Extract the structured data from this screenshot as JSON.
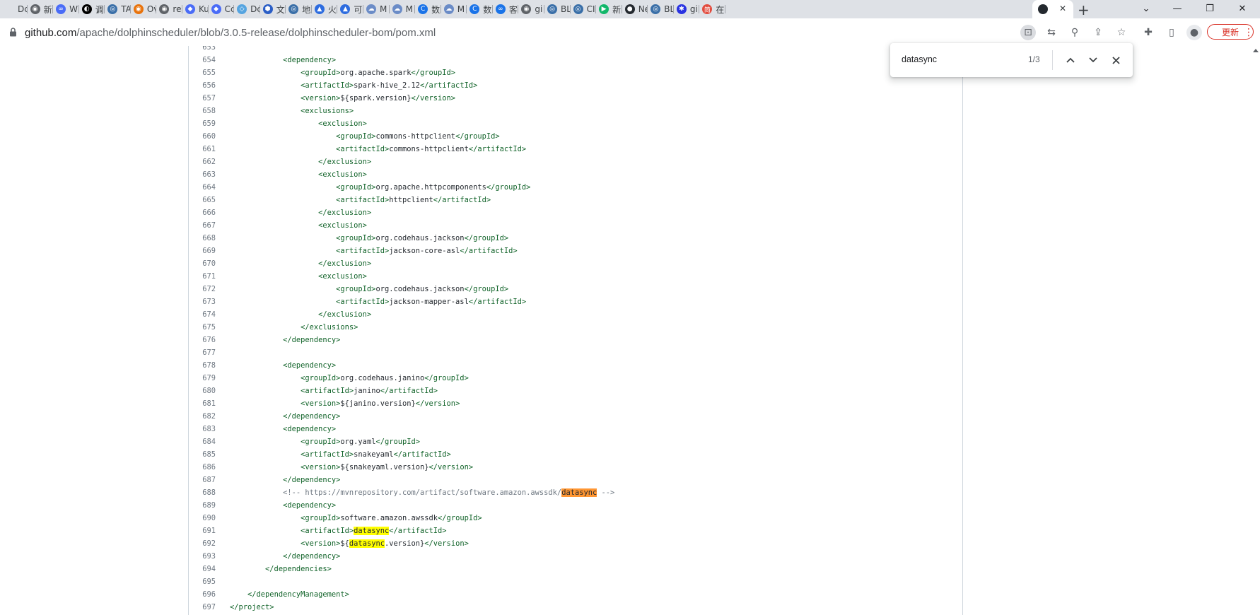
{
  "tabs": [
    {
      "label": "Dc",
      "icon": "doc-icon",
      "color": "#dee1e6",
      "glyph": ""
    },
    {
      "label": "新",
      "icon": "globe-icon",
      "color": "#5f6368",
      "glyph": "◉"
    },
    {
      "label": "W",
      "icon": "link-icon",
      "color": "#4a6cf7",
      "glyph": "∞"
    },
    {
      "label": "调",
      "icon": "compass-icon",
      "color": "#000000",
      "glyph": "◐"
    },
    {
      "label": "TA",
      "icon": "chrome-site-icon",
      "color": "#3a6fa8",
      "glyph": "◎"
    },
    {
      "label": "Ov",
      "icon": "orange-circle-icon",
      "color": "#e8730c",
      "glyph": "◉"
    },
    {
      "label": "re",
      "icon": "globe-icon",
      "color": "#5f6368",
      "glyph": "◉"
    },
    {
      "label": "Ku",
      "icon": "kuboard-icon",
      "color": "#4a6cf7",
      "glyph": "◆"
    },
    {
      "label": "Cc",
      "icon": "kuboard-icon",
      "color": "#4a6cf7",
      "glyph": "◆"
    },
    {
      "label": "Dc",
      "icon": "dolphin-icon",
      "color": "#55a4e0",
      "glyph": "◇"
    },
    {
      "label": "文",
      "icon": "hexagon-icon",
      "color": "#2b5ec6",
      "glyph": "⬢"
    },
    {
      "label": "地",
      "icon": "chrome-site-icon",
      "color": "#3a6fa8",
      "glyph": "◎"
    },
    {
      "label": "火",
      "icon": "volcano-icon",
      "color": "#2d6cdf",
      "glyph": "▲"
    },
    {
      "label": "可",
      "icon": "volcano-icon",
      "color": "#2d6cdf",
      "glyph": "▲"
    },
    {
      "label": "M",
      "icon": "cloud-icon",
      "color": "#6b8cc7",
      "glyph": "☁"
    },
    {
      "label": "M",
      "icon": "cloud-icon",
      "color": "#6b8cc7",
      "glyph": "☁"
    },
    {
      "label": "数",
      "icon": "c-logo-icon",
      "color": "#1a73e8",
      "glyph": "C"
    },
    {
      "label": "M",
      "icon": "cloud-icon",
      "color": "#6b8cc7",
      "glyph": "☁"
    },
    {
      "label": "数",
      "icon": "c-logo-icon",
      "color": "#1a73e8",
      "glyph": "C"
    },
    {
      "label": "客",
      "icon": "infinity-icon",
      "color": "#1a73e8",
      "glyph": "∞"
    },
    {
      "label": "gi",
      "icon": "globe-icon",
      "color": "#5f6368",
      "glyph": "◉"
    },
    {
      "label": "BL",
      "icon": "chrome-site-icon",
      "color": "#3a6fa8",
      "glyph": "◎"
    },
    {
      "label": "CI",
      "icon": "chrome-site-icon",
      "color": "#3a6fa8",
      "glyph": "◎"
    },
    {
      "label": "新",
      "icon": "play-icon",
      "color": "#12b76a",
      "glyph": "▶"
    },
    {
      "label": "Ne",
      "icon": "github-icon",
      "color": "#24292f",
      "glyph": "●"
    },
    {
      "label": "BL",
      "icon": "chrome-site-icon",
      "color": "#3a6fa8",
      "glyph": "◎"
    },
    {
      "label": "gi",
      "icon": "baidu-paw-icon",
      "color": "#2932e1",
      "glyph": "✱"
    },
    {
      "label": "在",
      "icon": "jian-icon",
      "color": "#e24c3f",
      "glyph": "简"
    }
  ],
  "active_tab": {
    "label": "",
    "icon": "github-icon",
    "close": "✕"
  },
  "new_tab": "+",
  "address": {
    "host": "github.com",
    "path": "/apache/dolphinscheduler/blob/3.0.5-release/dolphinscheduler-bom/pom.xml"
  },
  "update_button": "更新",
  "find": {
    "query": "datasync",
    "count": "1/3"
  },
  "code_lines": [
    {
      "n": "653",
      "text": ""
    },
    {
      "n": "654",
      "text": "            <dependency>"
    },
    {
      "n": "655",
      "text": "                <groupId>org.apache.spark</groupId>"
    },
    {
      "n": "656",
      "text": "                <artifactId>spark-hive_2.12</artifactId>"
    },
    {
      "n": "657",
      "text": "                <version>${spark.version}</version>"
    },
    {
      "n": "658",
      "text": "                <exclusions>"
    },
    {
      "n": "659",
      "text": "                    <exclusion>"
    },
    {
      "n": "660",
      "text": "                        <groupId>commons-httpclient</groupId>"
    },
    {
      "n": "661",
      "text": "                        <artifactId>commons-httpclient</artifactId>"
    },
    {
      "n": "662",
      "text": "                    </exclusion>"
    },
    {
      "n": "663",
      "text": "                    <exclusion>"
    },
    {
      "n": "664",
      "text": "                        <groupId>org.apache.httpcomponents</groupId>"
    },
    {
      "n": "665",
      "text": "                        <artifactId>httpclient</artifactId>"
    },
    {
      "n": "666",
      "text": "                    </exclusion>"
    },
    {
      "n": "667",
      "text": "                    <exclusion>"
    },
    {
      "n": "668",
      "text": "                        <groupId>org.codehaus.jackson</groupId>"
    },
    {
      "n": "669",
      "text": "                        <artifactId>jackson-core-asl</artifactId>"
    },
    {
      "n": "670",
      "text": "                    </exclusion>"
    },
    {
      "n": "671",
      "text": "                    <exclusion>"
    },
    {
      "n": "672",
      "text": "                        <groupId>org.codehaus.jackson</groupId>"
    },
    {
      "n": "673",
      "text": "                        <artifactId>jackson-mapper-asl</artifactId>"
    },
    {
      "n": "674",
      "text": "                    </exclusion>"
    },
    {
      "n": "675",
      "text": "                </exclusions>"
    },
    {
      "n": "676",
      "text": "            </dependency>"
    },
    {
      "n": "677",
      "text": ""
    },
    {
      "n": "678",
      "text": "            <dependency>"
    },
    {
      "n": "679",
      "text": "                <groupId>org.codehaus.janino</groupId>"
    },
    {
      "n": "680",
      "text": "                <artifactId>janino</artifactId>"
    },
    {
      "n": "681",
      "text": "                <version>${janino.version}</version>"
    },
    {
      "n": "682",
      "text": "            </dependency>"
    },
    {
      "n": "683",
      "text": "            <dependency>"
    },
    {
      "n": "684",
      "text": "                <groupId>org.yaml</groupId>"
    },
    {
      "n": "685",
      "text": "                <artifactId>snakeyaml</artifactId>"
    },
    {
      "n": "686",
      "text": "                <version>${snakeyaml.version}</version>"
    },
    {
      "n": "687",
      "text": "            </dependency>"
    },
    {
      "n": "688",
      "text": "            <!-- https://mvnrepository.com/artifact/software.amazon.awssdk/datasync -->",
      "comment": true,
      "highlight": "current"
    },
    {
      "n": "689",
      "text": "            <dependency>"
    },
    {
      "n": "690",
      "text": "                <groupId>software.amazon.awssdk</groupId>"
    },
    {
      "n": "691",
      "text": "                <artifactId>datasync</artifactId>",
      "highlight": "match"
    },
    {
      "n": "692",
      "text": "                <version>${datasync.version}</version>",
      "highlight": "match"
    },
    {
      "n": "693",
      "text": "            </dependency>"
    },
    {
      "n": "694",
      "text": "        </dependencies>"
    },
    {
      "n": "695",
      "text": ""
    },
    {
      "n": "696",
      "text": "    </dependencyManagement>"
    },
    {
      "n": "697",
      "text": "</project>"
    }
  ]
}
